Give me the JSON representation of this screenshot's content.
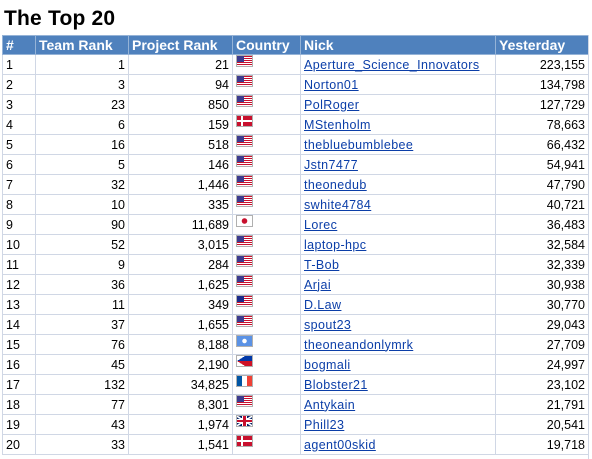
{
  "title": "The Top 20",
  "columns": [
    "#",
    "Team Rank",
    "Project Rank",
    "Country",
    "Nick",
    "Yesterday"
  ],
  "rows": [
    {
      "n": "1",
      "team": "1",
      "project": "21",
      "country": "us-flag",
      "nick": "Aperture_Science_Innovators",
      "yesterday": "223,155"
    },
    {
      "n": "2",
      "team": "3",
      "project": "94",
      "country": "us-flag",
      "nick": "Norton01",
      "yesterday": "134,798"
    },
    {
      "n": "3",
      "team": "23",
      "project": "850",
      "country": "us-flag",
      "nick": "PolRoger",
      "yesterday": "127,729"
    },
    {
      "n": "4",
      "team": "6",
      "project": "159",
      "country": "dk-flag",
      "nick": "MStenholm",
      "yesterday": "78,663"
    },
    {
      "n": "5",
      "team": "16",
      "project": "518",
      "country": "us-flag",
      "nick": "thebluebumblebee",
      "yesterday": "66,432"
    },
    {
      "n": "6",
      "team": "5",
      "project": "146",
      "country": "us-flag",
      "nick": "Jstn7477",
      "yesterday": "54,941"
    },
    {
      "n": "7",
      "team": "32",
      "project": "1,446",
      "country": "us-flag",
      "nick": "theonedub",
      "yesterday": "47,790"
    },
    {
      "n": "8",
      "team": "10",
      "project": "335",
      "country": "us-flag",
      "nick": "swhite4784",
      "yesterday": "40,721"
    },
    {
      "n": "9",
      "team": "90",
      "project": "11,689",
      "country": "jp-flag",
      "nick": "Lorec",
      "yesterday": "36,483"
    },
    {
      "n": "10",
      "team": "52",
      "project": "3,015",
      "country": "us-flag",
      "nick": "laptop-hpc",
      "yesterday": "32,584"
    },
    {
      "n": "11",
      "team": "9",
      "project": "284",
      "country": "us-flag",
      "nick": "T-Bob",
      "yesterday": "32,339"
    },
    {
      "n": "12",
      "team": "36",
      "project": "1,625",
      "country": "us-flag",
      "nick": "Arjai",
      "yesterday": "30,938"
    },
    {
      "n": "13",
      "team": "11",
      "project": "349",
      "country": "my-flag",
      "nick": "D.Law",
      "yesterday": "30,770"
    },
    {
      "n": "14",
      "team": "37",
      "project": "1,655",
      "country": "us-flag",
      "nick": "spout23",
      "yesterday": "29,043"
    },
    {
      "n": "15",
      "team": "76",
      "project": "8,188",
      "country": "un-flag",
      "nick": "theoneandonlymrk",
      "yesterday": "27,709"
    },
    {
      "n": "16",
      "team": "45",
      "project": "2,190",
      "country": "ph-flag",
      "nick": "bogmali",
      "yesterday": "24,997"
    },
    {
      "n": "17",
      "team": "132",
      "project": "34,825",
      "country": "fr-flag",
      "nick": "Blobster21",
      "yesterday": "23,102"
    },
    {
      "n": "18",
      "team": "77",
      "project": "8,301",
      "country": "us-flag",
      "nick": "Antykain",
      "yesterday": "21,791"
    },
    {
      "n": "19",
      "team": "43",
      "project": "1,974",
      "country": "gb-flag",
      "nick": "Phill23",
      "yesterday": "20,541"
    },
    {
      "n": "20",
      "team": "33",
      "project": "1,541",
      "country": "dk-flag",
      "nick": "agent00skid",
      "yesterday": "19,718"
    }
  ],
  "colors": {
    "header_bg": "#4f81bd",
    "header_text": "#ffffff",
    "link": "#0b3ea8",
    "grid": "#d0d7e5"
  }
}
